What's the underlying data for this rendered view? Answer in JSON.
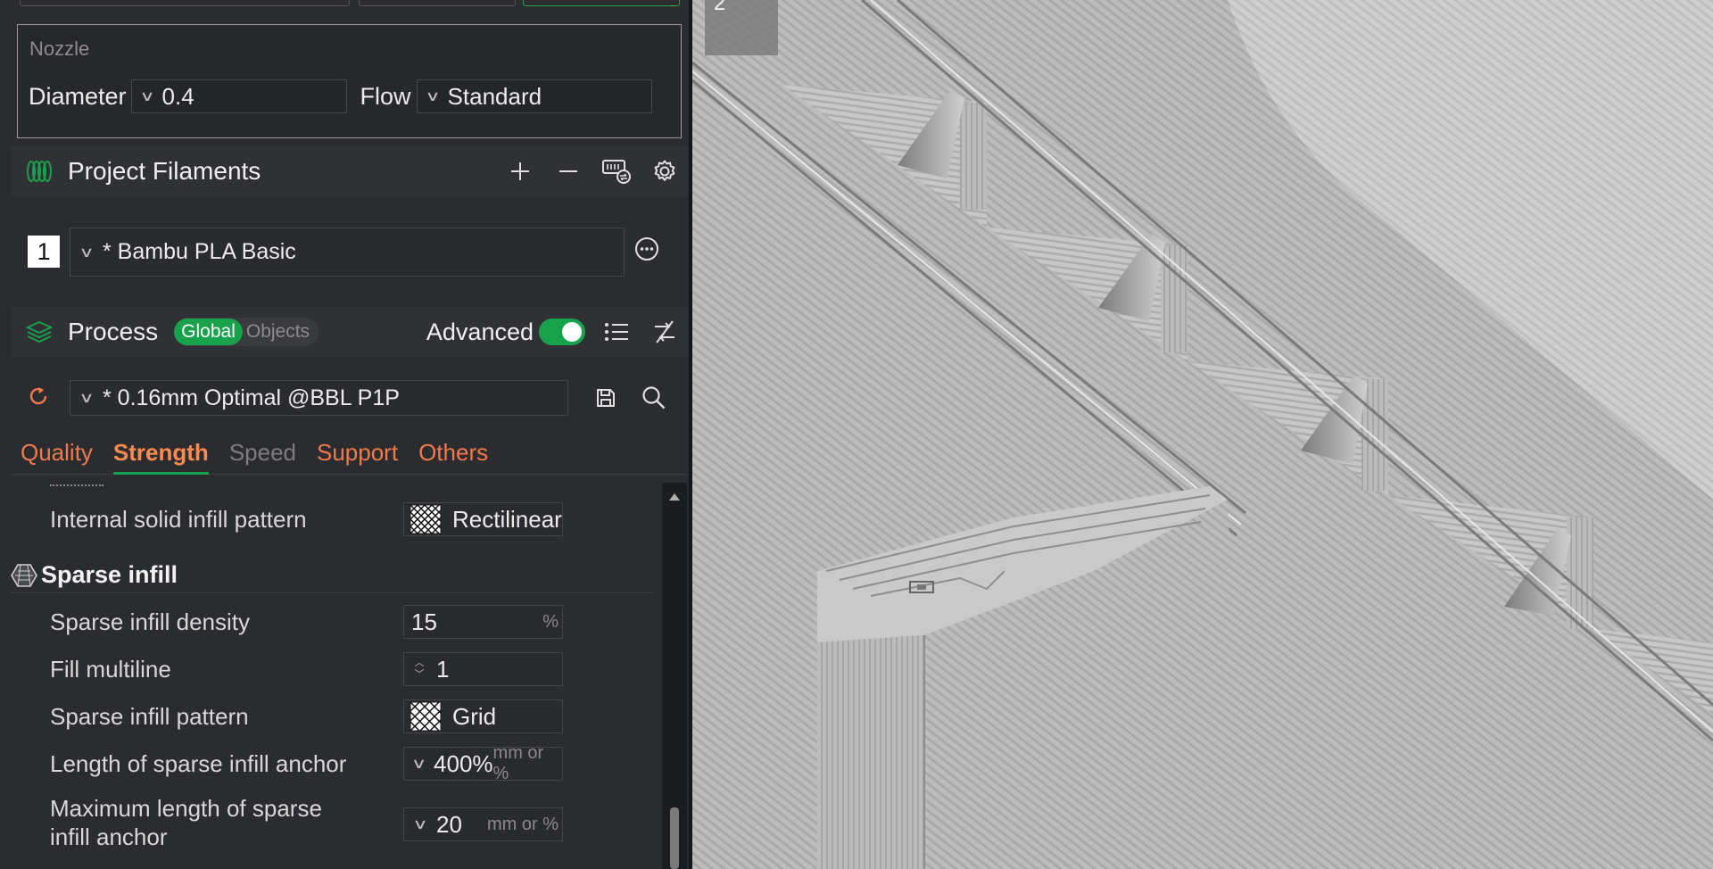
{
  "nozzle": {
    "title": "Nozzle",
    "diameter_label": "Diameter",
    "diameter_value": "0.4",
    "flow_label": "Flow",
    "flow_value": "Standard"
  },
  "filaments": {
    "title": "Project Filaments",
    "items": [
      {
        "index": "1",
        "name": "* Bambu PLA Basic"
      }
    ]
  },
  "process": {
    "title": "Process",
    "scope_global": "Global",
    "scope_objects": "Objects",
    "advanced_label": "Advanced",
    "advanced_on": true,
    "preset": "* 0.16mm Optimal @BBL P1P"
  },
  "tabs": [
    {
      "label": "Quality",
      "state": "normal"
    },
    {
      "label": "Strength",
      "state": "active"
    },
    {
      "label": "Speed",
      "state": "disabled"
    },
    {
      "label": "Support",
      "state": "normal"
    },
    {
      "label": "Others",
      "state": "normal"
    }
  ],
  "settings": {
    "internal_solid_pattern": {
      "label": "Internal solid infill pattern",
      "value": "Rectilinear"
    },
    "sparse_group_title": "Sparse infill",
    "density": {
      "label": "Sparse infill density",
      "value": "15",
      "unit": "%"
    },
    "multiline": {
      "label": "Fill multiline",
      "value": "1"
    },
    "pattern": {
      "label": "Sparse infill pattern",
      "value": "Grid"
    },
    "anchor_length": {
      "label": "Length of sparse infill anchor",
      "value": "400%",
      "unit": "mm or %"
    },
    "anchor_max": {
      "label_line1": "Maximum length of sparse",
      "label_line2": "infill anchor",
      "value": "20",
      "unit": "mm or %"
    }
  },
  "viewport": {
    "plate_number": "2"
  },
  "colors": {
    "accent_green": "#1aa14b",
    "tab_orange": "#f07a4a",
    "panel_bg": "#2b2c30"
  }
}
